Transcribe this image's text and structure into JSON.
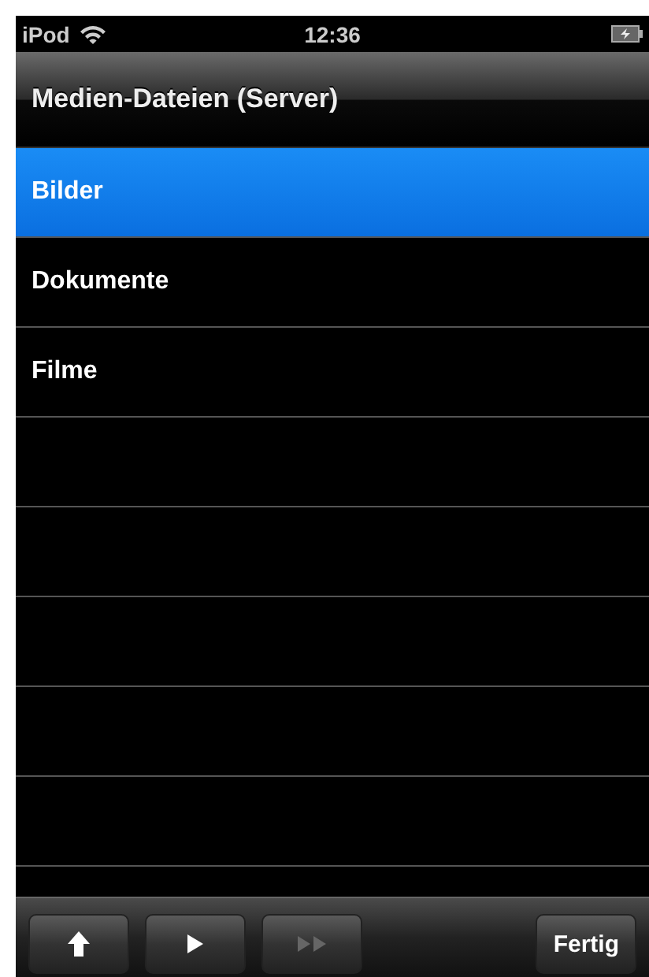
{
  "status_bar": {
    "carrier": "iPod",
    "time": "12:36"
  },
  "nav_bar": {
    "title": "Medien-Dateien (Server)"
  },
  "list": [
    {
      "label": "Bilder",
      "selected": true
    },
    {
      "label": "Dokumente",
      "selected": false
    },
    {
      "label": "Filme",
      "selected": false
    }
  ],
  "toolbar": {
    "buttons": [
      {
        "kind": "up",
        "disabled": false
      },
      {
        "kind": "play",
        "disabled": false
      },
      {
        "kind": "forward",
        "disabled": true
      }
    ],
    "done": "Fertig"
  }
}
